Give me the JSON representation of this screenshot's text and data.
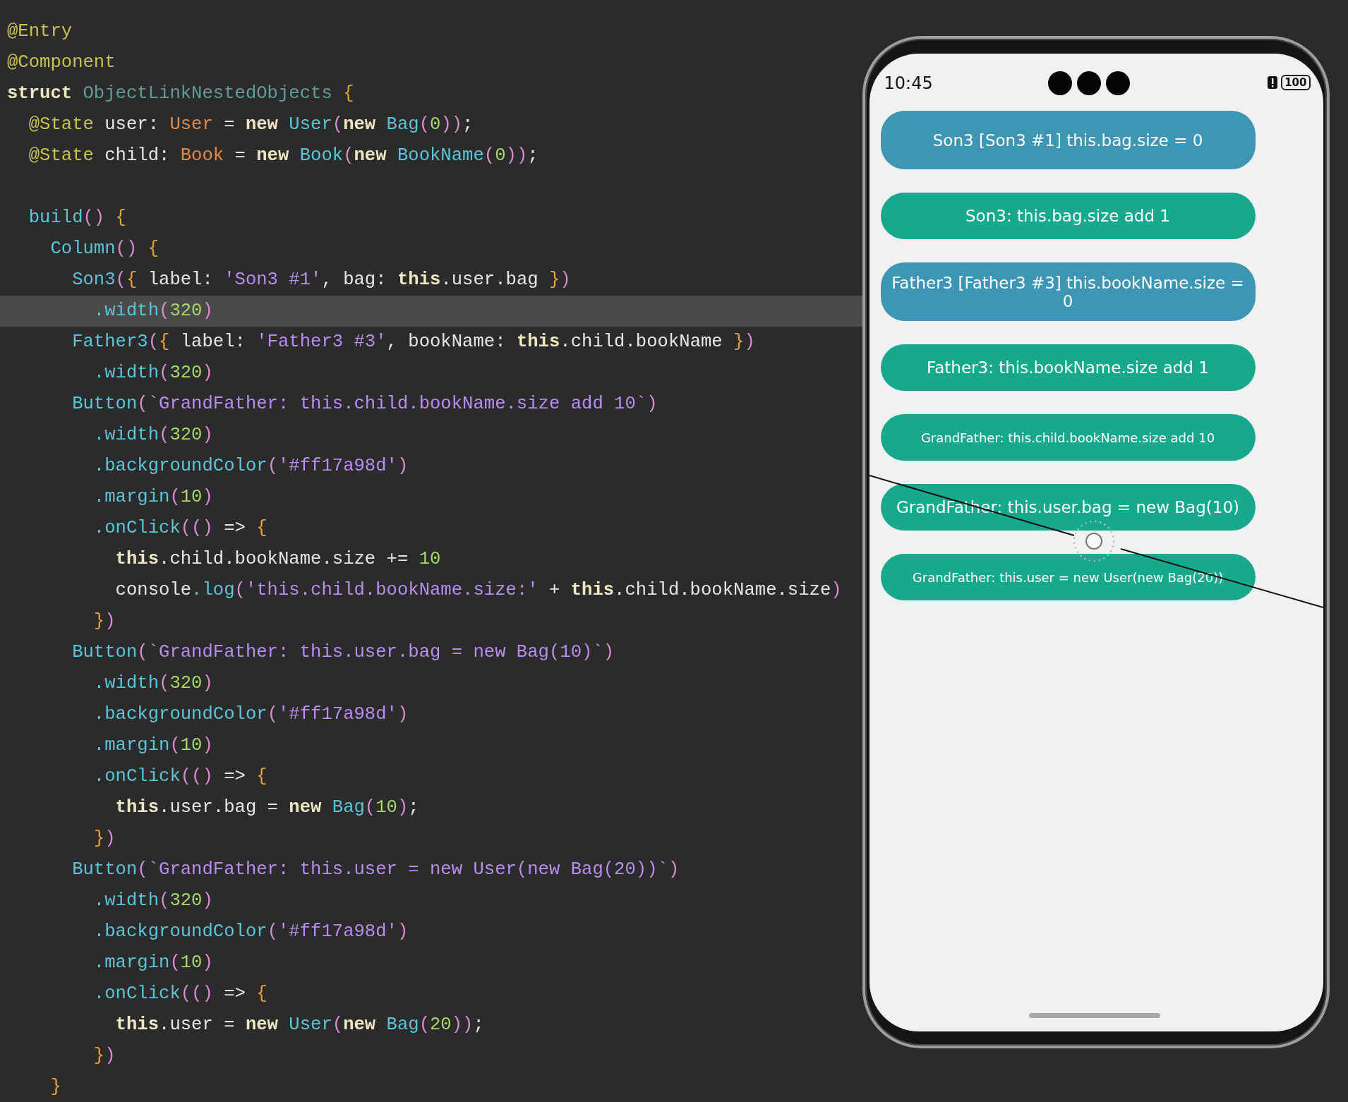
{
  "editor": {
    "lines": [
      {
        "current": false,
        "tokens": [
          {
            "text": "@Entry",
            "kind": "annotation"
          }
        ]
      },
      {
        "current": false,
        "tokens": [
          {
            "text": "@Component",
            "kind": "annotation"
          }
        ]
      },
      {
        "current": false,
        "tokens": [
          {
            "text": "struct ",
            "kind": "keyword"
          },
          {
            "text": "ObjectLinkNestedObjects ",
            "kind": "name"
          },
          {
            "text": "{",
            "kind": "brace"
          }
        ]
      },
      {
        "current": false,
        "tokens": [
          {
            "text": "  @State ",
            "kind": "annotation"
          },
          {
            "text": "user: ",
            "kind": "plain"
          },
          {
            "text": "User",
            "kind": "class"
          },
          {
            "text": " = ",
            "kind": "plain"
          },
          {
            "text": "new ",
            "kind": "keyword"
          },
          {
            "text": "User",
            "kind": "type"
          },
          {
            "text": "(",
            "kind": "paren"
          },
          {
            "text": "new ",
            "kind": "keyword"
          },
          {
            "text": "Bag",
            "kind": "type"
          },
          {
            "text": "(",
            "kind": "paren"
          },
          {
            "text": "0",
            "kind": "number"
          },
          {
            "text": "))",
            "kind": "paren"
          },
          {
            "text": ";",
            "kind": "plain"
          }
        ]
      },
      {
        "current": false,
        "tokens": [
          {
            "text": "  @State ",
            "kind": "annotation"
          },
          {
            "text": "child: ",
            "kind": "plain"
          },
          {
            "text": "Book",
            "kind": "class"
          },
          {
            "text": " = ",
            "kind": "plain"
          },
          {
            "text": "new ",
            "kind": "keyword"
          },
          {
            "text": "Book",
            "kind": "type"
          },
          {
            "text": "(",
            "kind": "paren"
          },
          {
            "text": "new ",
            "kind": "keyword"
          },
          {
            "text": "BookName",
            "kind": "type"
          },
          {
            "text": "(",
            "kind": "paren"
          },
          {
            "text": "0",
            "kind": "number"
          },
          {
            "text": "))",
            "kind": "paren"
          },
          {
            "text": ";",
            "kind": "plain"
          }
        ]
      },
      {
        "current": false
      },
      {
        "current": false,
        "tokens": [
          {
            "text": "  build",
            "kind": "type"
          },
          {
            "text": "()",
            "kind": "paren"
          },
          {
            "text": " {",
            "kind": "brace"
          }
        ]
      },
      {
        "current": false,
        "tokens": [
          {
            "text": "    Column",
            "kind": "type"
          },
          {
            "text": "()",
            "kind": "paren"
          },
          {
            "text": " {",
            "kind": "brace"
          }
        ]
      },
      {
        "current": false,
        "tokens": [
          {
            "text": "      Son3",
            "kind": "type"
          },
          {
            "text": "(",
            "kind": "paren"
          },
          {
            "text": "{",
            "kind": "brace"
          },
          {
            "text": " label: ",
            "kind": "plain"
          },
          {
            "text": "'Son3 #1'",
            "kind": "string"
          },
          {
            "text": ", bag: ",
            "kind": "plain"
          },
          {
            "text": "this",
            "kind": "keyword"
          },
          {
            "text": ".user.bag ",
            "kind": "plain"
          },
          {
            "text": "}",
            "kind": "brace"
          },
          {
            "text": ")",
            "kind": "paren"
          }
        ]
      },
      {
        "current": true,
        "tokens": [
          {
            "text": "        .width",
            "kind": "type"
          },
          {
            "text": "(",
            "kind": "paren"
          },
          {
            "text": "320",
            "kind": "number"
          },
          {
            "text": ")",
            "kind": "paren"
          }
        ]
      },
      {
        "current": false,
        "tokens": [
          {
            "text": "      Father3",
            "kind": "type"
          },
          {
            "text": "(",
            "kind": "paren"
          },
          {
            "text": "{",
            "kind": "brace"
          },
          {
            "text": " label: ",
            "kind": "plain"
          },
          {
            "text": "'Father3 #3'",
            "kind": "string"
          },
          {
            "text": ", bookName: ",
            "kind": "plain"
          },
          {
            "text": "this",
            "kind": "keyword"
          },
          {
            "text": ".child.bookName ",
            "kind": "plain"
          },
          {
            "text": "}",
            "kind": "brace"
          },
          {
            "text": ")",
            "kind": "paren"
          }
        ]
      },
      {
        "current": false,
        "tokens": [
          {
            "text": "        .width",
            "kind": "type"
          },
          {
            "text": "(",
            "kind": "paren"
          },
          {
            "text": "320",
            "kind": "number"
          },
          {
            "text": ")",
            "kind": "paren"
          }
        ]
      },
      {
        "current": false,
        "tokens": [
          {
            "text": "      Button",
            "kind": "type"
          },
          {
            "text": "(",
            "kind": "paren"
          },
          {
            "text": "`GrandFather: this.child.bookName.size add 10`",
            "kind": "string"
          },
          {
            "text": ")",
            "kind": "paren"
          }
        ]
      },
      {
        "current": false,
        "tokens": [
          {
            "text": "        .width",
            "kind": "type"
          },
          {
            "text": "(",
            "kind": "paren"
          },
          {
            "text": "320",
            "kind": "number"
          },
          {
            "text": ")",
            "kind": "paren"
          }
        ]
      },
      {
        "current": false,
        "tokens": [
          {
            "text": "        .backgroundColor",
            "kind": "type"
          },
          {
            "text": "(",
            "kind": "paren"
          },
          {
            "text": "'#ff17a98d'",
            "kind": "string"
          },
          {
            "text": ")",
            "kind": "paren"
          }
        ]
      },
      {
        "current": false,
        "tokens": [
          {
            "text": "        .margin",
            "kind": "type"
          },
          {
            "text": "(",
            "kind": "paren"
          },
          {
            "text": "10",
            "kind": "number"
          },
          {
            "text": ")",
            "kind": "paren"
          }
        ]
      },
      {
        "current": false,
        "tokens": [
          {
            "text": "        .onClick",
            "kind": "type"
          },
          {
            "text": "(()",
            "kind": "paren"
          },
          {
            "text": " => ",
            "kind": "plain"
          },
          {
            "text": "{",
            "kind": "brace"
          }
        ]
      },
      {
        "current": false,
        "tokens": [
          {
            "text": "          this",
            "kind": "keyword"
          },
          {
            "text": ".child.bookName.size += ",
            "kind": "plain"
          },
          {
            "text": "10",
            "kind": "number"
          }
        ]
      },
      {
        "current": false,
        "tokens": [
          {
            "text": "          console",
            "kind": "plain"
          },
          {
            "text": ".log",
            "kind": "type"
          },
          {
            "text": "(",
            "kind": "paren"
          },
          {
            "text": "'this.child.bookName.size:'",
            "kind": "string"
          },
          {
            "text": " + ",
            "kind": "plain"
          },
          {
            "text": "this",
            "kind": "keyword"
          },
          {
            "text": ".child.bookName.size",
            "kind": "plain"
          },
          {
            "text": ")",
            "kind": "paren"
          }
        ]
      },
      {
        "current": false,
        "tokens": [
          {
            "text": "        }",
            "kind": "brace"
          },
          {
            "text": ")",
            "kind": "paren"
          }
        ]
      },
      {
        "current": false,
        "tokens": [
          {
            "text": "      Button",
            "kind": "type"
          },
          {
            "text": "(",
            "kind": "paren"
          },
          {
            "text": "`GrandFather: this.user.bag = new Bag(10)`",
            "kind": "string"
          },
          {
            "text": ")",
            "kind": "paren"
          }
        ]
      },
      {
        "current": false,
        "tokens": [
          {
            "text": "        .width",
            "kind": "type"
          },
          {
            "text": "(",
            "kind": "paren"
          },
          {
            "text": "320",
            "kind": "number"
          },
          {
            "text": ")",
            "kind": "paren"
          }
        ]
      },
      {
        "current": false,
        "tokens": [
          {
            "text": "        .backgroundColor",
            "kind": "type"
          },
          {
            "text": "(",
            "kind": "paren"
          },
          {
            "text": "'#ff17a98d'",
            "kind": "string"
          },
          {
            "text": ")",
            "kind": "paren"
          }
        ]
      },
      {
        "current": false,
        "tokens": [
          {
            "text": "        .margin",
            "kind": "type"
          },
          {
            "text": "(",
            "kind": "paren"
          },
          {
            "text": "10",
            "kind": "number"
          },
          {
            "text": ")",
            "kind": "paren"
          }
        ]
      },
      {
        "current": false,
        "tokens": [
          {
            "text": "        .onClick",
            "kind": "type"
          },
          {
            "text": "(()",
            "kind": "paren"
          },
          {
            "text": " => ",
            "kind": "plain"
          },
          {
            "text": "{",
            "kind": "brace"
          }
        ]
      },
      {
        "current": false,
        "tokens": [
          {
            "text": "          this",
            "kind": "keyword"
          },
          {
            "text": ".user.bag = ",
            "kind": "plain"
          },
          {
            "text": "new ",
            "kind": "keyword"
          },
          {
            "text": "Bag",
            "kind": "type"
          },
          {
            "text": "(",
            "kind": "paren"
          },
          {
            "text": "10",
            "kind": "number"
          },
          {
            "text": ")",
            "kind": "paren"
          },
          {
            "text": ";",
            "kind": "plain"
          }
        ]
      },
      {
        "current": false,
        "tokens": [
          {
            "text": "        }",
            "kind": "brace"
          },
          {
            "text": ")",
            "kind": "paren"
          }
        ]
      },
      {
        "current": false,
        "tokens": [
          {
            "text": "      Button",
            "kind": "type"
          },
          {
            "text": "(",
            "kind": "paren"
          },
          {
            "text": "`GrandFather: this.user = new User(new Bag(20))`",
            "kind": "string"
          },
          {
            "text": ")",
            "kind": "paren"
          }
        ]
      },
      {
        "current": false,
        "tokens": [
          {
            "text": "        .width",
            "kind": "type"
          },
          {
            "text": "(",
            "kind": "paren"
          },
          {
            "text": "320",
            "kind": "number"
          },
          {
            "text": ")",
            "kind": "paren"
          }
        ]
      },
      {
        "current": false,
        "tokens": [
          {
            "text": "        .backgroundColor",
            "kind": "type"
          },
          {
            "text": "(",
            "kind": "paren"
          },
          {
            "text": "'#ff17a98d'",
            "kind": "string"
          },
          {
            "text": ")",
            "kind": "paren"
          }
        ]
      },
      {
        "current": false,
        "tokens": [
          {
            "text": "        .margin",
            "kind": "type"
          },
          {
            "text": "(",
            "kind": "paren"
          },
          {
            "text": "10",
            "kind": "number"
          },
          {
            "text": ")",
            "kind": "paren"
          }
        ]
      },
      {
        "current": false,
        "tokens": [
          {
            "text": "        .onClick",
            "kind": "type"
          },
          {
            "text": "(()",
            "kind": "paren"
          },
          {
            "text": " => ",
            "kind": "plain"
          },
          {
            "text": "{",
            "kind": "brace"
          }
        ]
      },
      {
        "current": false,
        "tokens": [
          {
            "text": "          this",
            "kind": "keyword"
          },
          {
            "text": ".user = ",
            "kind": "plain"
          },
          {
            "text": "new ",
            "kind": "keyword"
          },
          {
            "text": "User",
            "kind": "type"
          },
          {
            "text": "(",
            "kind": "paren"
          },
          {
            "text": "new ",
            "kind": "keyword"
          },
          {
            "text": "Bag",
            "kind": "type"
          },
          {
            "text": "(",
            "kind": "paren"
          },
          {
            "text": "20",
            "kind": "number"
          },
          {
            "text": "))",
            "kind": "paren"
          },
          {
            "text": ";",
            "kind": "plain"
          }
        ]
      },
      {
        "current": false,
        "tokens": [
          {
            "text": "        }",
            "kind": "brace"
          },
          {
            "text": ")",
            "kind": "paren"
          }
        ]
      },
      {
        "current": false,
        "tokens": [
          {
            "text": "    }",
            "kind": "brace"
          }
        ]
      }
    ]
  },
  "phone": {
    "status_bar": {
      "time": "10:45",
      "battery": "100"
    },
    "items": [
      {
        "kind": "text",
        "label": "Son3 [Son3 #1] this.bag.size = 0",
        "color": "#3d96b4",
        "small": false
      },
      {
        "kind": "button",
        "label": "Son3: this.bag.size add 1",
        "color": "#17a98d",
        "small": false
      },
      {
        "kind": "text",
        "label": "Father3 [Father3 #3] this.bookName.size = 0",
        "color": "#3d96b4",
        "small": false
      },
      {
        "kind": "button",
        "label": "Father3: this.bookName.size add 1",
        "color": "#17a98d",
        "small": false
      },
      {
        "kind": "button",
        "label": "GrandFather: this.child.bookName.size add 10",
        "color": "#17a98d",
        "small": true
      },
      {
        "kind": "button",
        "label": "GrandFather: this.user.bag = new Bag(10)",
        "color": "#17a98d",
        "small": false
      },
      {
        "kind": "button",
        "label": "GrandFather: this.user = new User(new Bag(20))",
        "color": "#17a98d",
        "small": true
      }
    ]
  }
}
